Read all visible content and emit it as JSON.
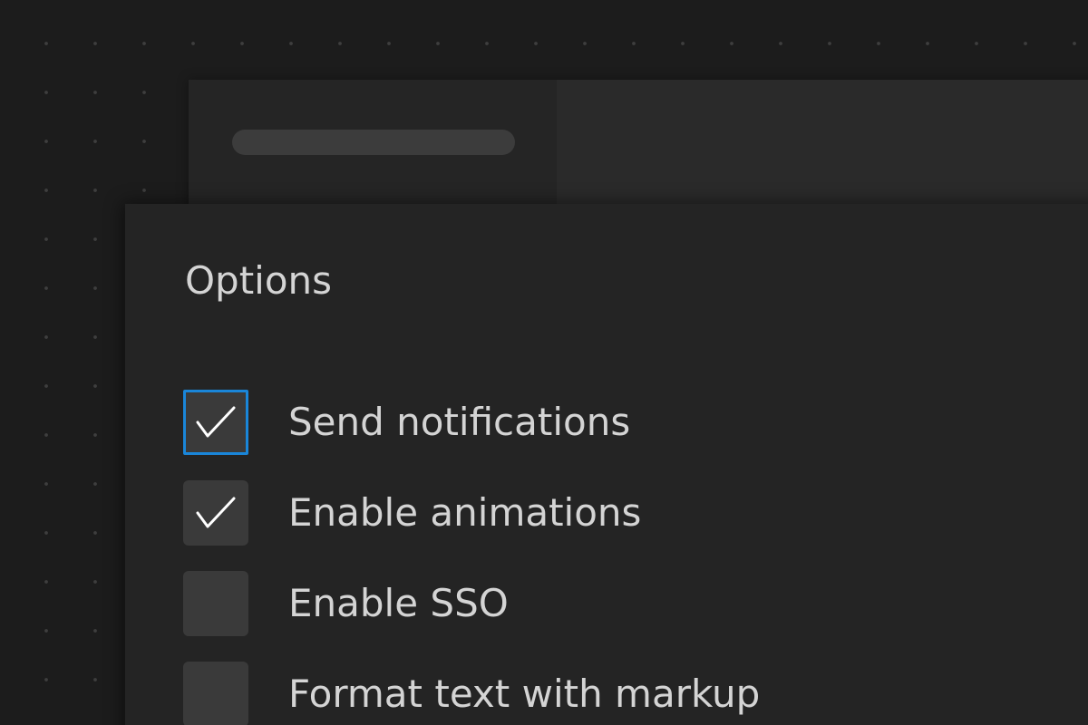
{
  "panel": {
    "title": "Options"
  },
  "options": [
    {
      "label": "Send notifications",
      "checked": true,
      "focused": true
    },
    {
      "label": "Enable animations",
      "checked": true,
      "focused": false
    },
    {
      "label": "Enable SSO",
      "checked": false,
      "focused": false
    },
    {
      "label": "Format text with markup",
      "checked": false,
      "focused": false
    }
  ],
  "colors": {
    "focus_ring": "#1a86d9",
    "checkbox_fill": "#3a3a3a",
    "check_mark": "#ffffff",
    "text": "#d4d4d4"
  },
  "icons": {
    "check": "checkmark-icon"
  }
}
